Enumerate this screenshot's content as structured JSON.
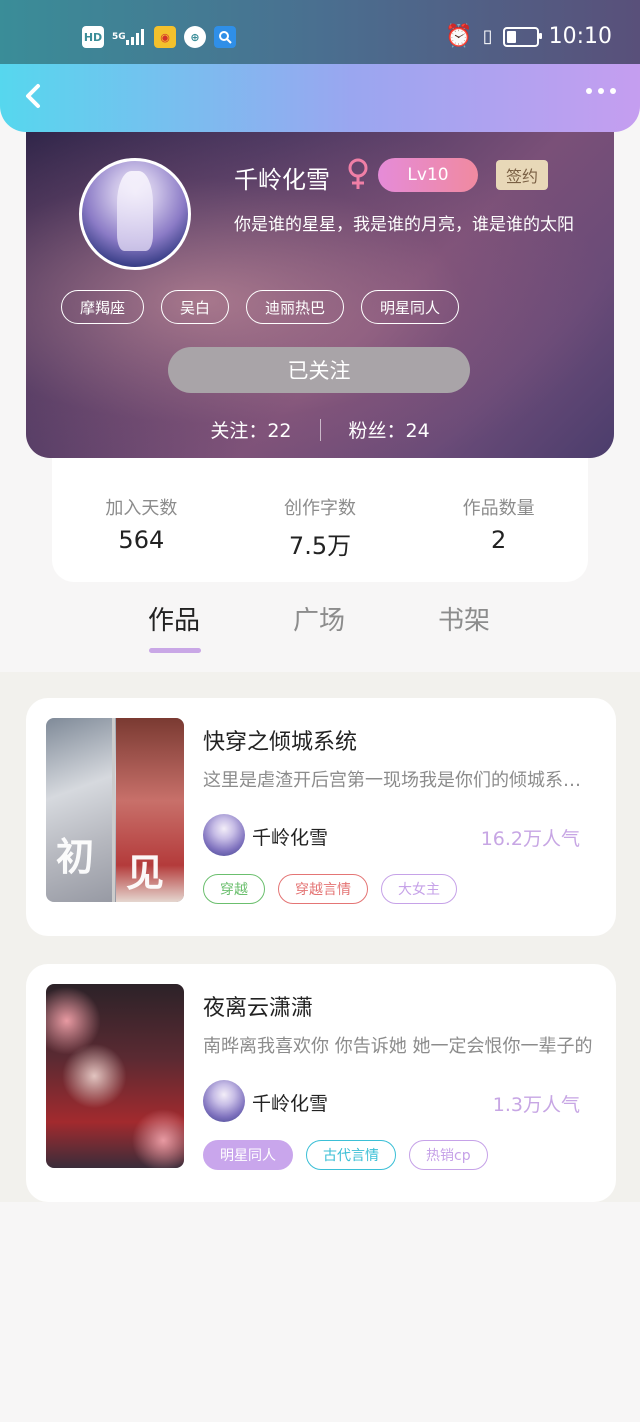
{
  "status_bar": {
    "time": "10:10",
    "chips": [
      "HD",
      "5G"
    ]
  },
  "profile": {
    "name": "千岭化雪",
    "level": "Lv10",
    "sign_badge": "签约",
    "bio": "你是谁的星星，我是谁的月亮，谁是谁的太阳",
    "tags": [
      "摩羯座",
      "吴白",
      "迪丽热巴",
      "明星同人"
    ],
    "follow_button": "已关注",
    "following": "关注：22",
    "fans": "粉丝：24"
  },
  "stats": [
    {
      "label": "加入天数",
      "value": "564"
    },
    {
      "label": "创作字数",
      "value": "7.5万"
    },
    {
      "label": "作品数量",
      "value": "2"
    }
  ],
  "tabs": [
    {
      "label": "作品",
      "active": true
    },
    {
      "label": "广场",
      "active": false
    },
    {
      "label": "书架",
      "active": false
    }
  ],
  "works": [
    {
      "title": "快穿之倾城系统",
      "desc": "这里是虐渣开后宫第一现场我是你们的倾城系统，快来加入吧",
      "author": "千岭化雪",
      "popularity": "16.2万人气",
      "cover_text": [
        "初",
        "见"
      ],
      "tags": [
        {
          "label": "穿越",
          "color": "#6bbf6e",
          "fill": ""
        },
        {
          "label": "穿越言情",
          "color": "#e47575",
          "fill": ""
        },
        {
          "label": "大女主",
          "color": "#c6a2e8",
          "fill": ""
        }
      ]
    },
    {
      "title": "夜离云潇潇",
      "desc": "南晔离我喜欢你 你告诉她 她一定会恨你一辈子的",
      "author": "千岭化雪",
      "popularity": "1.3万人气",
      "tags": [
        {
          "label": "明星同人",
          "color": "#ffffff",
          "fill": "#c9a6ec"
        },
        {
          "label": "古代言情",
          "color": "#3bbfd6",
          "fill": ""
        },
        {
          "label": "热销cp",
          "color": "#c6a2e8",
          "fill": ""
        }
      ]
    }
  ],
  "colors": {
    "accent": "#c9a7e6",
    "popularity": "#c7a6e4"
  }
}
